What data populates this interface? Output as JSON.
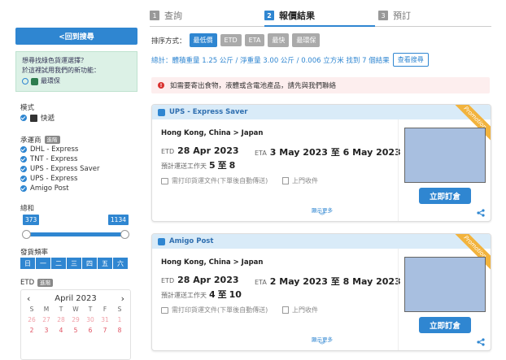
{
  "sidebar": {
    "back_label": "<回到搜尋",
    "promo_line1": "想尋找綠色貨運選擇？",
    "promo_line2": "於這裡試用我們的新功能：",
    "promo_option": "最環保",
    "mode_title": "模式",
    "mode_value": "快遞",
    "carrier_title": "承運商",
    "advanced_badge": "進階",
    "carriers": [
      "DHL - Express",
      "TNT - Express",
      "UPS - Express Saver",
      "UPS - Express",
      "Amigo Post"
    ],
    "total_title": "總和",
    "total_min": "373",
    "total_max": "1134",
    "freq_title": "發貨頻率",
    "freq_days": [
      "日",
      "一",
      "二",
      "三",
      "四",
      "五",
      "六"
    ],
    "etd_title": "ETD",
    "calendar": {
      "month": "April 2023",
      "prev_icon": "chevron-left-icon",
      "next_icon": "chevron-right-icon",
      "weekdays": [
        "S",
        "M",
        "T",
        "W",
        "T",
        "F",
        "S"
      ],
      "prev_row": [
        "26",
        "27",
        "28",
        "29",
        "30",
        "31",
        "1"
      ],
      "cur_row": [
        "2",
        "3",
        "4",
        "5",
        "6",
        "7",
        "8"
      ]
    }
  },
  "steps": [
    {
      "num": "1",
      "label": "查詢"
    },
    {
      "num": "2",
      "label": "報價結果"
    },
    {
      "num": "3",
      "label": "預訂"
    }
  ],
  "sort": {
    "label": "排序方式：",
    "options": [
      "最低價",
      "ETD",
      "ETA",
      "最快",
      "最環保"
    ]
  },
  "summary": {
    "text": "總計：體積重量 1.25 公斤 / 淨重量 3.00 公斤 / 0.006 立方米 找到 7 個結果",
    "view_label": "查看搜尋"
  },
  "alert": {
    "icon": "!",
    "text": "如需要寄出食物，液體或含電池產品，請先與我們聯絡"
  },
  "cards": [
    {
      "carrier": "UPS - Express Saver",
      "ribbon": "Promotion",
      "route": "Hong Kong, China > Japan",
      "etd_label": "ETD",
      "etd": "28 Apr 2023",
      "eta_label": "ETA",
      "eta": "3 May 2023 至 6 May 2023",
      "transit_label": "預計運送工作天",
      "transit_min": "5",
      "transit_sep": "至",
      "transit_max": "8",
      "feature1": "需打印貨運文件(下單後自動傳送)",
      "feature2": "上門收件",
      "more": "顯示更多",
      "order_label": "立即訂倉"
    },
    {
      "carrier": "Amigo Post",
      "ribbon": "Promotion",
      "route": "Hong Kong, China > Japan",
      "etd_label": "ETD",
      "etd": "28 Apr 2023",
      "eta_label": "ETA",
      "eta": "2 May 2023 至 8 May 2023",
      "transit_label": "預計運送工作天",
      "transit_min": "4",
      "transit_sep": "至",
      "transit_max": "10",
      "feature1": "需打印貨運文件(下單後自動傳送)",
      "feature2": "上門收件",
      "more": "顯示更多",
      "order_label": "立即訂倉"
    }
  ]
}
